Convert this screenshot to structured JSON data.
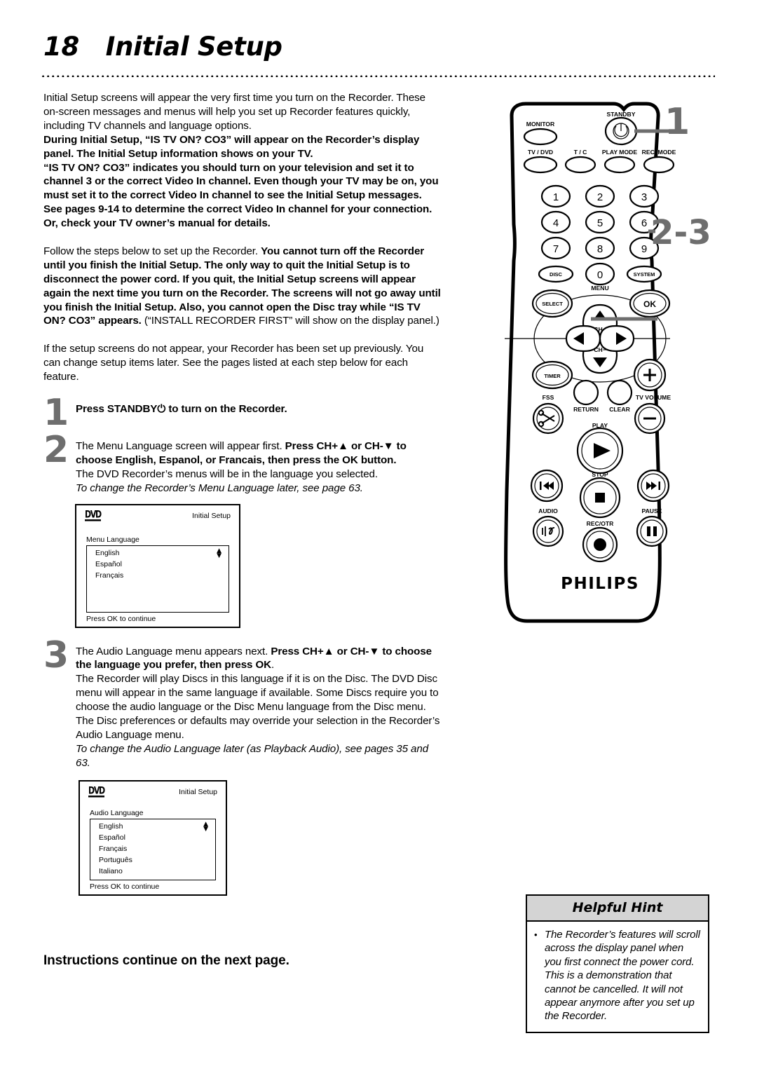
{
  "page": {
    "number": "18",
    "title": "Initial Setup",
    "title_full": "18   Initial Setup"
  },
  "intro": {
    "p1": "Initial Setup screens will appear the very first time you turn on the Recorder. These on-screen messages and menus will help you set up Recorder features quickly, including TV channels and language options.",
    "p2_bold": "During Initial Setup, “IS TV ON? CO3” will appear on the Recorder’s display panel. The Initial Setup information shows on your TV.",
    "p3_bold": "“IS TV ON? CO3” indicates you should turn on your television and set it to channel 3 or the correct Video In channel. Even though your TV may be on, you must set it to the correct Video In channel to see the Initial Setup messages. See pages 9-14 to determine the correct Video In channel for your connection. Or, check your TV owner’s manual for details.",
    "p4_normal_lead": "Follow the steps below to set up the Recorder. ",
    "p4_bold": "You cannot turn off the Recorder until you finish the Initial Setup. The only way to quit the Initial Setup is to disconnect the power cord. If you quit, the Initial Setup screens will appear again the next time you turn on the Recorder. The screens will not go away until you finish the Initial Setup.  Also, you cannot open the Disc tray while “IS TV ON? CO3” appears. ",
    "p4_tail": "(“INSTALL RECORDER FIRST” will show on the display panel.)",
    "p5": "If the setup screens do not appear, your Recorder has been set up previously. You can change setup items later. See the pages listed at each step below for each feature."
  },
  "steps": [
    {
      "num": "1",
      "bold": "Press STANDBY⏻ to turn on the Recorder.",
      "normal": "",
      "italic": ""
    },
    {
      "num": "2",
      "lead_normal": "The Menu Language screen will appear first. ",
      "bold": "Press CH+▲ or CH-▼ to choose English, Espanol, or Francais, then press the OK button.",
      "normal": "The DVD Recorder’s menus will be in the language you selected.",
      "italic": "To change the Recorder’s Menu Language later, see page 63."
    },
    {
      "num": "3",
      "lead_normal": "The Audio Language menu appears next. ",
      "bold": "Press CH+▲ or CH-▼ to choose the language you prefer, then press OK",
      "bold_tail": ".",
      "normal": "The Recorder will play Discs in this language if it is on the Disc. The DVD Disc menu will appear in the same language if available. Some Discs require you to choose the audio language or the Disc Menu language from the Disc menu. The Disc preferences or defaults may override your selection in the Recorder’s Audio Language menu.",
      "italic": "To change the Audio Language later (as Playback Audio), see pages 35 and 63."
    }
  ],
  "screens": [
    {
      "logo": "DVD",
      "header_right": "Initial Setup",
      "field_label": "Menu Language",
      "items": [
        "English",
        "Español",
        "Français"
      ],
      "scroll_up": "▲",
      "scroll_down": "▼",
      "footer": "Press OK to continue"
    },
    {
      "logo": "DVD",
      "header_right": "Initial Setup",
      "field_label": "Audio Language",
      "items": [
        "English",
        "Español",
        "Français",
        "Português",
        "Italiano"
      ],
      "scroll_up": "▲",
      "scroll_down": "▼",
      "footer": "Press OK to continue"
    }
  ],
  "continue_text": "Instructions continue on the next page.",
  "callouts": {
    "one": "1",
    "two_three": "2-3"
  },
  "remote": {
    "brand": "PHILIPS",
    "labels": {
      "monitor": "MONITOR",
      "standby": "STANDBY",
      "tv_dvd": "TV / DVD",
      "tc": "T / C",
      "play_mode": "PLAY MODE",
      "rec_mode": "REC. MODE",
      "disc": "DISC",
      "system": "SYSTEM",
      "menu": "MENU",
      "select": "SELECT",
      "ok": "OK",
      "ch_plus": "CH+",
      "ch_minus": "CH−",
      "timer": "TIMER",
      "fss": "FSS",
      "return": "RETURN",
      "clear": "CLEAR",
      "tv_volume": "TV VOLUME",
      "play": "PLAY",
      "stop": "STOP",
      "audio": "AUDIO",
      "rec_otr": "REC/OTR",
      "pause": "PAUSE"
    },
    "keypad": [
      "1",
      "2",
      "3",
      "4",
      "5",
      "6",
      "7",
      "8",
      "9",
      "0"
    ]
  },
  "hint": {
    "title": "Helpful Hint",
    "bullet": "•",
    "text": "The Recorder’s features will scroll across the display panel when you first connect the power cord. This is a demonstration that cannot be cancelled. It will not appear anymore after you set up the Recorder."
  },
  "colors": {
    "step_number_gray": "#6e6e6e",
    "hint_header_gray": "#d4d4d4",
    "text_black": "#000000"
  }
}
